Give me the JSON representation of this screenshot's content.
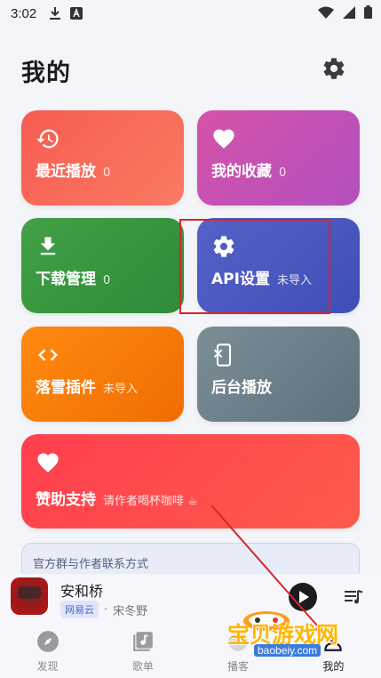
{
  "status_bar": {
    "time": "3:02"
  },
  "header": {
    "title": "我的"
  },
  "cards": {
    "recent": {
      "label": "最近播放",
      "count": "0"
    },
    "favorites": {
      "label": "我的收藏",
      "count": "0"
    },
    "downloads": {
      "label": "下载管理",
      "count": "0"
    },
    "api": {
      "label": "API设置",
      "status": "未导入"
    },
    "plugin": {
      "label": "落雪插件",
      "status": "未导入"
    },
    "background": {
      "label": "后台播放"
    },
    "donate": {
      "label": "赞助支持",
      "subtitle": "请作者喝杯咖啡 ☕"
    }
  },
  "contact": {
    "label": "官方群与作者联系方式"
  },
  "player": {
    "title": "安和桥",
    "source": "网易云",
    "artist": "宋冬野",
    "separator": "·"
  },
  "nav": [
    {
      "label": "发现"
    },
    {
      "label": "歌单"
    },
    {
      "label": "播客"
    },
    {
      "label": "我的"
    }
  ],
  "watermark": {
    "text": "宝贝游戏网",
    "url": "baobeiy.com"
  },
  "colors": {
    "recent": "#f65c52",
    "favorites": "#c250b3",
    "downloads": "#3a9640",
    "api": "#4a58c0",
    "plugin": "#fb7c09",
    "background": "#6d808a",
    "donate": "#ff4850",
    "highlight": "#d4262a"
  }
}
